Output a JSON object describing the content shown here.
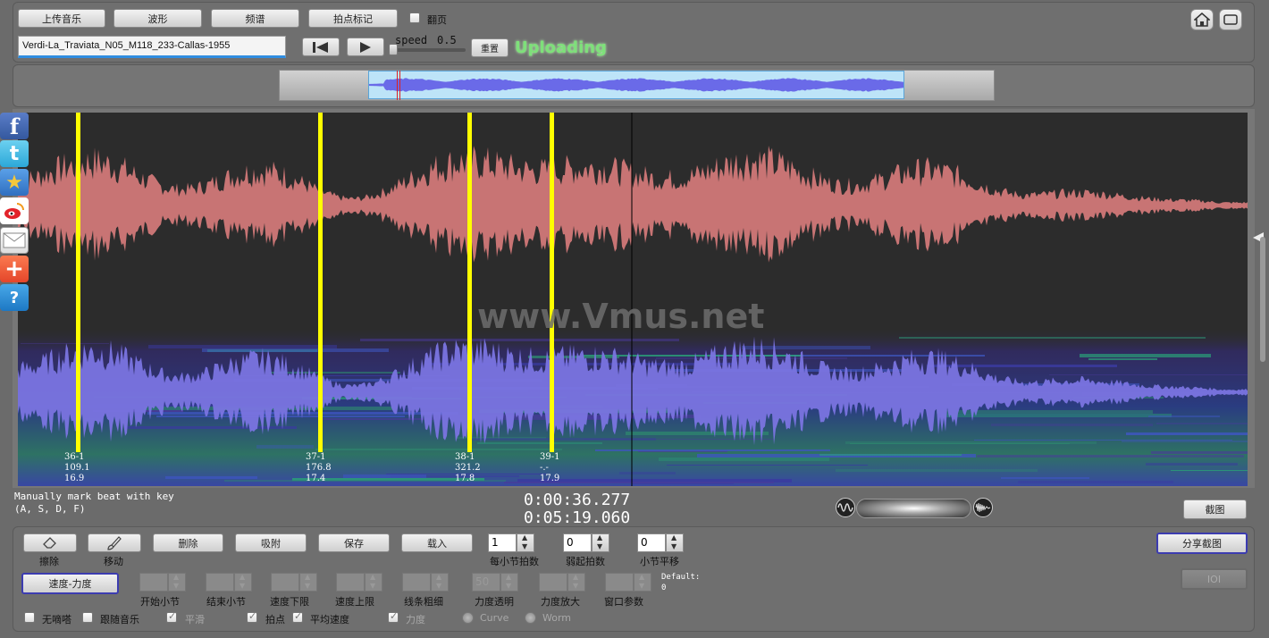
{
  "toolbar": {
    "upload_label": "上传音乐",
    "waveform_label": "波形",
    "spectrum_label": "频谱",
    "beat_mark_label": "拍点标记",
    "page_flip_label": "翻页",
    "reset_label": "重置",
    "speed_label": "speed",
    "speed_value": "0.5",
    "status": "Uploading"
  },
  "track": {
    "title": "Verdi-La_Traviata_N05_M118_233-Callas-1955"
  },
  "overlay": {
    "watermark": "www.Vmus.net"
  },
  "beats": [
    {
      "line1": "36-1",
      "line2": "109.1",
      "line3": "16.9"
    },
    {
      "line1": "37-1",
      "line2": "176.8",
      "line3": "17.4"
    },
    {
      "line1": "38-1",
      "line2": "321.2",
      "line3": "17.8"
    },
    {
      "line1": "39-1",
      "line2": "-.-",
      "line3": "17.9"
    }
  ],
  "hint": {
    "line1": "Manually mark beat with key",
    "line2": "(A, S, D, F)"
  },
  "time": {
    "current": "0:00:36.277",
    "total": "0:05:19.060"
  },
  "screenshot_label": "截图",
  "share_label": "分享截图",
  "ioi_label": "IOI",
  "tools": {
    "erase_label": "擦除",
    "move_label": "移动",
    "delete_label": "删除",
    "snap_label": "吸附",
    "save_label": "保存",
    "load_label": "载入"
  },
  "params": {
    "beats_per_bar": {
      "label": "每小节拍数",
      "value": "1"
    },
    "pickup": {
      "label": "弱起拍数",
      "value": "0"
    },
    "bar_offset": {
      "label": "小节平移",
      "value": "0"
    }
  },
  "mode_button": "速度-力度",
  "range_params": [
    {
      "label": "开始小节"
    },
    {
      "label": "结束小节"
    },
    {
      "label": "速度下限"
    },
    {
      "label": "速度上限"
    },
    {
      "label": "线条粗细"
    },
    {
      "label": "力度透明",
      "value": "50"
    },
    {
      "label": "力度放大"
    },
    {
      "label": "窗口参数"
    }
  ],
  "default_note": {
    "line1": "Default:",
    "line2": "0"
  },
  "options": {
    "no_click": "无嘀嗒",
    "follow_music": "跟随音乐",
    "smooth": "平滑",
    "beat_point": "拍点",
    "avg_speed": "平均速度",
    "dynamics": "力度",
    "curve": "Curve",
    "worm": "Worm"
  },
  "colors": {
    "beat_line": "#ffff00",
    "top_wave": "#c87474",
    "bottom_wave": "#7a74e0",
    "status_green": "#7ee07a",
    "overview_wave": "#6a6ae8"
  },
  "icons": [
    "home-icon",
    "fullscreen-icon",
    "skip-back-icon",
    "play-icon",
    "eraser-icon",
    "brush-icon",
    "facebook-icon",
    "twitter-icon",
    "favorite-icon",
    "weibo-icon",
    "mail-icon",
    "add-icon",
    "help-icon"
  ]
}
